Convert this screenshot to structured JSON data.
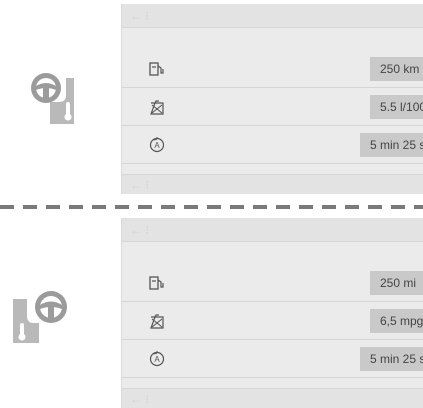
{
  "top": {
    "rows": [
      {
        "icon": "fuel-range-icon",
        "value": "250 km"
      },
      {
        "icon": "fuel-consumption-icon",
        "value": "5.5 l/100"
      },
      {
        "icon": "timer-icon",
        "value": "5 min 25 s"
      }
    ]
  },
  "bottom": {
    "rows": [
      {
        "icon": "fuel-range-icon",
        "value": "250 mi"
      },
      {
        "icon": "fuel-consumption-icon",
        "value": "6,5 mpg"
      },
      {
        "icon": "timer-icon",
        "value": "5 min 25 s"
      }
    ]
  },
  "nav": {
    "back_glyph": "← ⁝"
  },
  "colors": {
    "panel": "#ebebeb",
    "value_box": "#c9c9c9",
    "dash": "#7a7a7a"
  }
}
